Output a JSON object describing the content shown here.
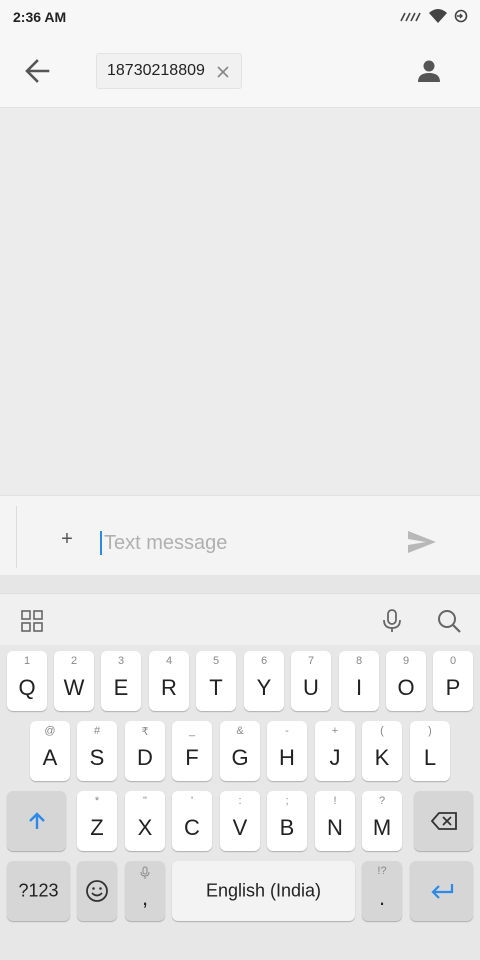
{
  "status": {
    "time": "2:36 AM"
  },
  "header": {
    "recipient": "18730218809"
  },
  "compose": {
    "placeholder": "Text message",
    "attach_label": "+"
  },
  "keyboard": {
    "row1": [
      {
        "main": "Q",
        "hint": "1"
      },
      {
        "main": "W",
        "hint": "2"
      },
      {
        "main": "E",
        "hint": "3"
      },
      {
        "main": "R",
        "hint": "4"
      },
      {
        "main": "T",
        "hint": "5"
      },
      {
        "main": "Y",
        "hint": "6"
      },
      {
        "main": "U",
        "hint": "7"
      },
      {
        "main": "I",
        "hint": "8"
      },
      {
        "main": "O",
        "hint": "9"
      },
      {
        "main": "P",
        "hint": "0"
      }
    ],
    "row2": [
      {
        "main": "A",
        "hint": "@"
      },
      {
        "main": "S",
        "hint": "#"
      },
      {
        "main": "D",
        "hint": "₹"
      },
      {
        "main": "F",
        "hint": "_"
      },
      {
        "main": "G",
        "hint": "&"
      },
      {
        "main": "H",
        "hint": "-"
      },
      {
        "main": "J",
        "hint": "+"
      },
      {
        "main": "K",
        "hint": "("
      },
      {
        "main": "L",
        "hint": ")"
      }
    ],
    "row3": [
      {
        "main": "Z",
        "hint": "*"
      },
      {
        "main": "X",
        "hint": "\""
      },
      {
        "main": "C",
        "hint": "'"
      },
      {
        "main": "V",
        "hint": ":"
      },
      {
        "main": "B",
        "hint": ";"
      },
      {
        "main": "N",
        "hint": "!"
      },
      {
        "main": "M",
        "hint": "?"
      }
    ],
    "symbols_label": "?123",
    "comma_label": ",",
    "space_label": "English (India)",
    "period_label": ".",
    "period_hint": "!?"
  },
  "colors": {
    "accent": "#2d8ae6",
    "key_bg": "#ffffff",
    "keyboard_bg": "#e7e7e7"
  }
}
